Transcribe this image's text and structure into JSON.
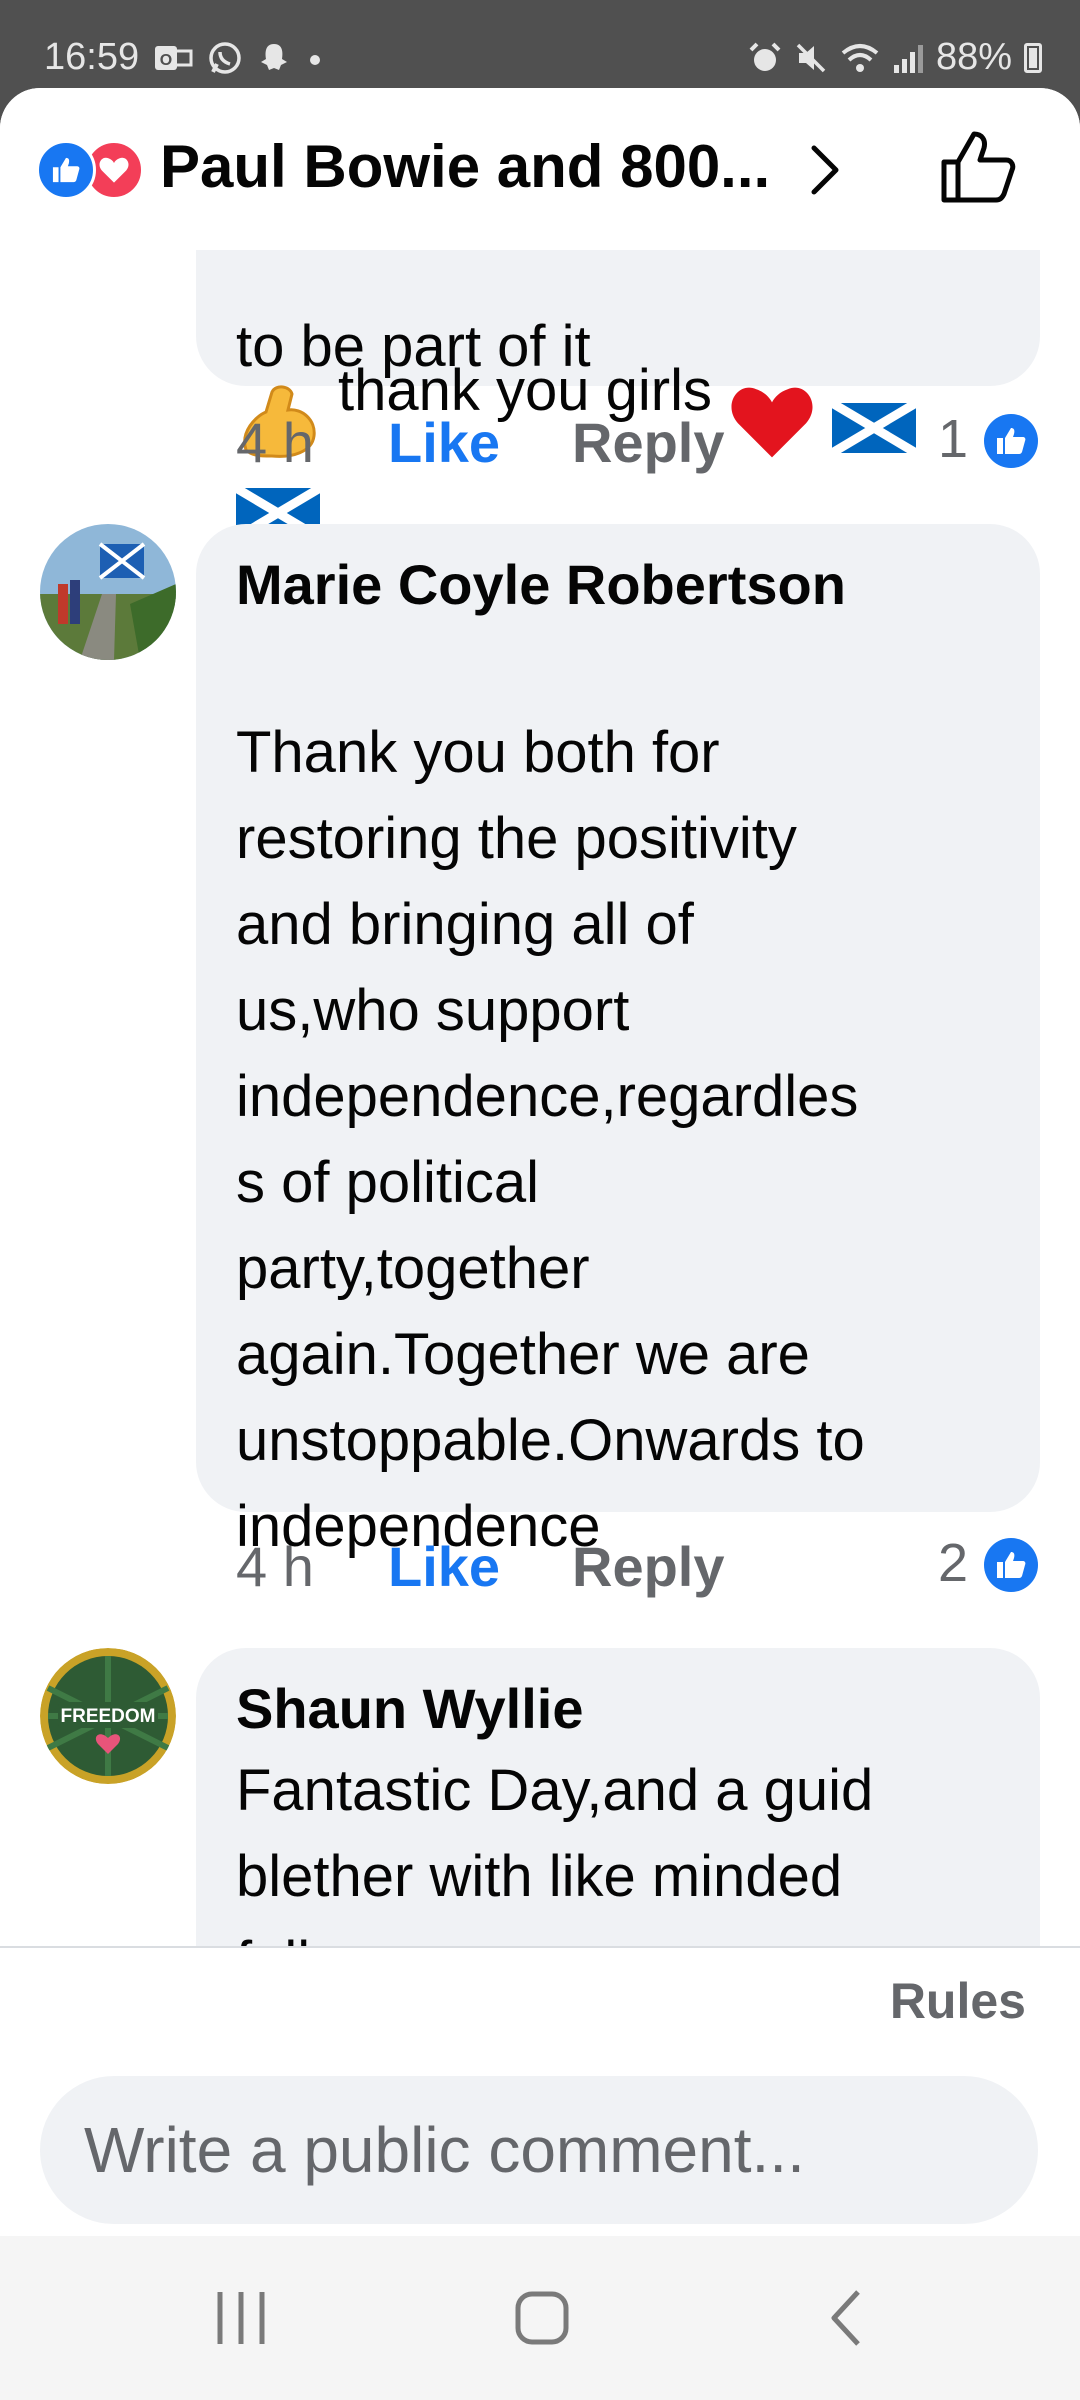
{
  "status_bar": {
    "time": "16:59",
    "battery": "88%",
    "left_icons": [
      "outlook-icon",
      "whatsapp-icon",
      "snapchat-icon",
      "dot-icon"
    ],
    "right_icons": [
      "alarm-icon",
      "mute-icon",
      "wifi-icon",
      "signal-icon",
      "battery-icon"
    ]
  },
  "header": {
    "title": "Paul Bowie and 800...",
    "reactions": [
      "like",
      "love"
    ]
  },
  "comments": [
    {
      "partial_top_text": "to be part of it",
      "text": "thank you girls",
      "time": "4 h",
      "like_label": "Like",
      "reply_label": "Reply",
      "reaction_count": "1"
    },
    {
      "author": "Marie Coyle Robertson",
      "text": "Thank you both for\nrestoring the positivity\nand bringing all of\nus,who support\nindependence,regardles\ns of political\nparty,together\nagain.Together we are\nunstoppable.Onwards to\nindependence",
      "time": "4 h",
      "like_label": "Like",
      "reply_label": "Reply",
      "reaction_count": "2"
    },
    {
      "author": "Shaun Wyllie",
      "text": "Fantastic Day,and a guid\nblether with like minded\nfolk",
      "avatar_text": "FREEDOM"
    }
  ],
  "footer": {
    "rules_label": "Rules",
    "comment_placeholder": "Write a public comment..."
  },
  "colors": {
    "accent": "#1877f2",
    "love": "#f33e58",
    "bubble": "#f0f2f5",
    "secondary_text": "#65676b"
  }
}
